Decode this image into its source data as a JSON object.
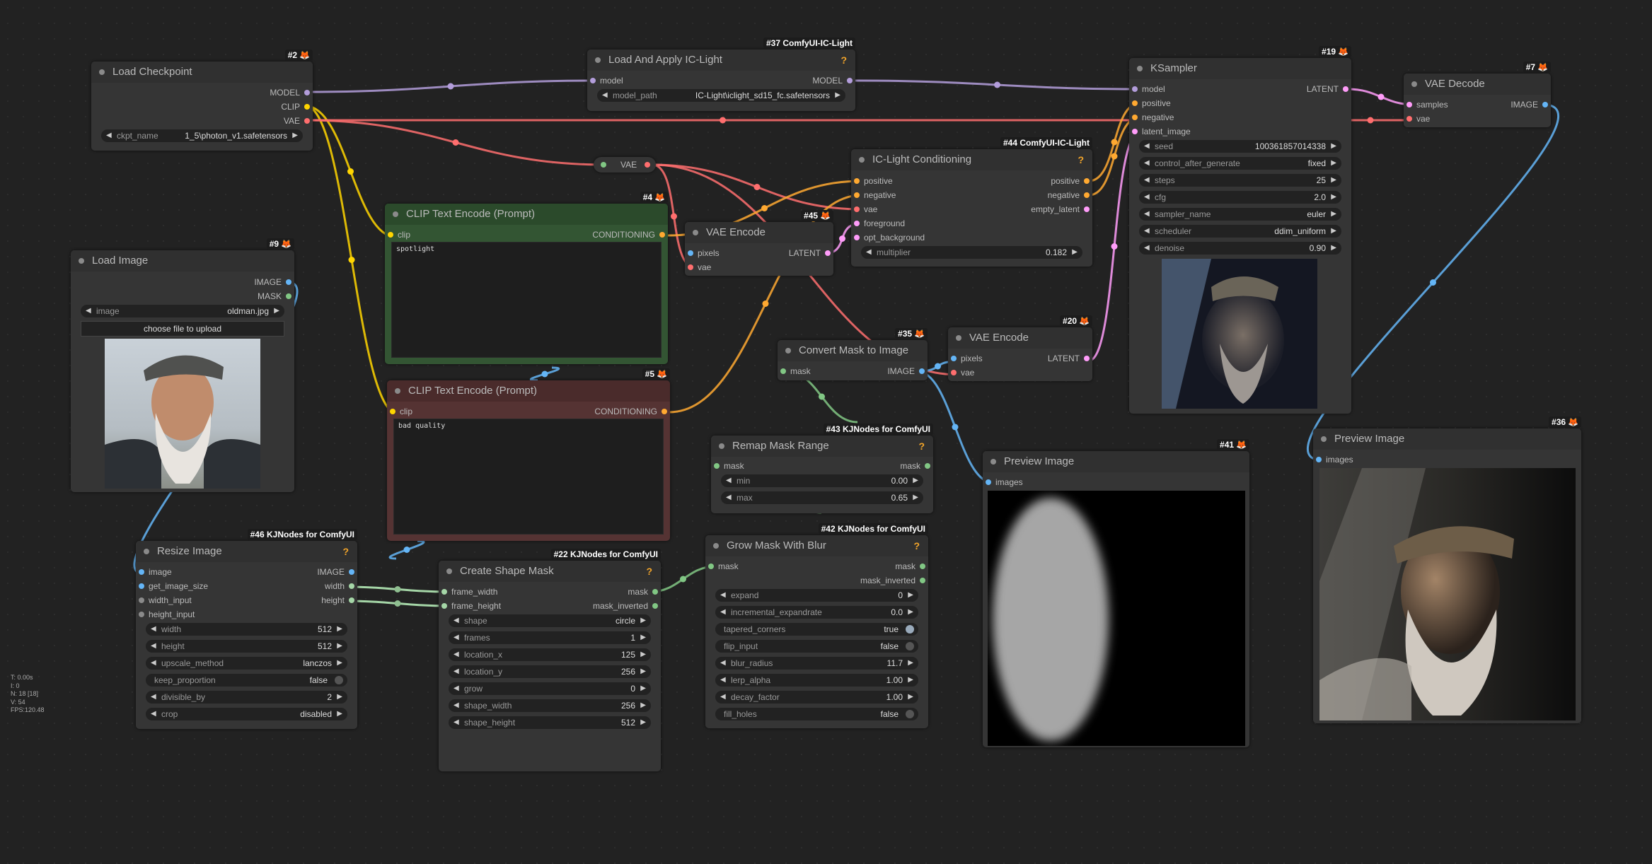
{
  "stats": [
    "T: 0.00s",
    "I: 0",
    "N: 18 [18]",
    "V: 54",
    "FPS:120.48"
  ],
  "colors": {
    "model": "#b39ddb",
    "clip": "#ffd500",
    "vae": "#ff6e6e",
    "conditioning": "#ffa931",
    "latent": "#ff9cf9",
    "image": "#64b5f6",
    "mask": "#81c784"
  },
  "nodes": {
    "load_checkpoint": {
      "title": "Load Checkpoint",
      "badge": "#2",
      "outputs": [
        "MODEL",
        "CLIP",
        "VAE"
      ],
      "ckpt_name_label": "ckpt_name",
      "ckpt_name": "1_5\\photon_v1.safetensors"
    },
    "load_iclight": {
      "title": "Load And Apply IC-Light",
      "badge": "#37 ComfyUI-IC-Light",
      "in_model": "model",
      "out_model": "MODEL",
      "model_path_label": "model_path",
      "model_path": "IC-Light\\iclight_sd15_fc.safetensors"
    },
    "vae_reroute": {
      "label": "VAE"
    },
    "ksampler": {
      "title": "KSampler",
      "badge": "#19",
      "inputs": [
        "model",
        "positive",
        "negative",
        "latent_image"
      ],
      "out": "LATENT",
      "widgets": [
        {
          "name": "seed",
          "value": "100361857014338"
        },
        {
          "name": "control_after_generate",
          "value": "fixed"
        },
        {
          "name": "steps",
          "value": "25"
        },
        {
          "name": "cfg",
          "value": "2.0"
        },
        {
          "name": "sampler_name",
          "value": "euler"
        },
        {
          "name": "scheduler",
          "value": "ddim_uniform"
        },
        {
          "name": "denoise",
          "value": "0.90"
        }
      ]
    },
    "vae_decode": {
      "title": "VAE Decode",
      "badge": "#7",
      "in_samples": "samples",
      "in_vae": "vae",
      "out": "IMAGE"
    },
    "iclight_cond": {
      "title": "IC-Light Conditioning",
      "badge": "#44 ComfyUI-IC-Light",
      "inputs": [
        "positive",
        "negative",
        "vae",
        "foreground",
        "opt_background"
      ],
      "outputs": [
        "positive",
        "negative",
        "empty_latent"
      ],
      "multiplier_label": "multiplier",
      "multiplier": "0.182"
    },
    "load_image": {
      "title": "Load Image",
      "badge": "#9",
      "outputs": [
        "IMAGE",
        "MASK"
      ],
      "image_label": "image",
      "image": "oldman.jpg",
      "upload": "choose file to upload"
    },
    "clip_pos": {
      "title": "CLIP Text Encode (Prompt)",
      "badge": "#4",
      "in": "clip",
      "out": "CONDITIONING",
      "text": "spotlight"
    },
    "clip_neg": {
      "title": "CLIP Text Encode (Prompt)",
      "badge": "#5",
      "in": "clip",
      "out": "CONDITIONING",
      "text": "bad quality"
    },
    "vae_encode_45": {
      "title": "VAE Encode",
      "badge": "#45",
      "inputs": [
        "pixels",
        "vae"
      ],
      "out": "LATENT"
    },
    "vae_encode_20": {
      "title": "VAE Encode",
      "badge": "#20",
      "inputs": [
        "pixels",
        "vae"
      ],
      "out": "LATENT"
    },
    "convert_mask": {
      "title": "Convert Mask to Image",
      "badge": "#35",
      "in": "mask",
      "out": "IMAGE"
    },
    "remap_mask": {
      "title": "Remap Mask Range",
      "badge": "#43 KJNodes for ComfyUI",
      "in": "mask",
      "out": "mask",
      "widgets": [
        {
          "name": "min",
          "value": "0.00"
        },
        {
          "name": "max",
          "value": "0.65"
        }
      ]
    },
    "grow_mask": {
      "title": "Grow Mask With Blur",
      "badge": "#42 KJNodes for ComfyUI",
      "in": "mask",
      "outputs": [
        "mask",
        "mask_inverted"
      ],
      "widgets": [
        {
          "name": "expand",
          "value": "0",
          "type": "num"
        },
        {
          "name": "incremental_expandrate",
          "value": "0.0",
          "type": "num"
        },
        {
          "name": "tapered_corners",
          "value": "true",
          "type": "toggle"
        },
        {
          "name": "flip_input",
          "value": "false",
          "type": "toggle"
        },
        {
          "name": "blur_radius",
          "value": "11.7",
          "type": "num"
        },
        {
          "name": "lerp_alpha",
          "value": "1.00",
          "type": "num"
        },
        {
          "name": "decay_factor",
          "value": "1.00",
          "type": "num"
        },
        {
          "name": "fill_holes",
          "value": "false",
          "type": "toggle"
        }
      ]
    },
    "preview_41": {
      "title": "Preview Image",
      "badge": "#41",
      "in": "images"
    },
    "preview_36": {
      "title": "Preview Image",
      "badge": "#36",
      "in": "images"
    },
    "resize_image": {
      "title": "Resize Image",
      "badge": "#46 KJNodes for ComfyUI",
      "inputs": [
        "image",
        "get_image_size",
        "width_input",
        "height_input"
      ],
      "outputs": [
        "IMAGE",
        "width",
        "height"
      ],
      "widgets": [
        {
          "name": "width",
          "value": "512",
          "type": "num"
        },
        {
          "name": "height",
          "value": "512",
          "type": "num"
        },
        {
          "name": "upscale_method",
          "value": "lanczos",
          "type": "num"
        },
        {
          "name": "keep_proportion",
          "value": "false",
          "type": "toggle"
        },
        {
          "name": "divisible_by",
          "value": "2",
          "type": "num"
        },
        {
          "name": "crop",
          "value": "disabled",
          "type": "num"
        }
      ]
    },
    "create_shape": {
      "title": "Create Shape Mask",
      "badge": "#22 KJNodes for ComfyUI",
      "inputs": [
        "frame_width",
        "frame_height"
      ],
      "outputs": [
        "mask",
        "mask_inverted"
      ],
      "widgets": [
        {
          "name": "shape",
          "value": "circle"
        },
        {
          "name": "frames",
          "value": "1"
        },
        {
          "name": "location_x",
          "value": "125"
        },
        {
          "name": "location_y",
          "value": "256"
        },
        {
          "name": "grow",
          "value": "0"
        },
        {
          "name": "shape_width",
          "value": "256"
        },
        {
          "name": "shape_height",
          "value": "512"
        }
      ]
    }
  }
}
